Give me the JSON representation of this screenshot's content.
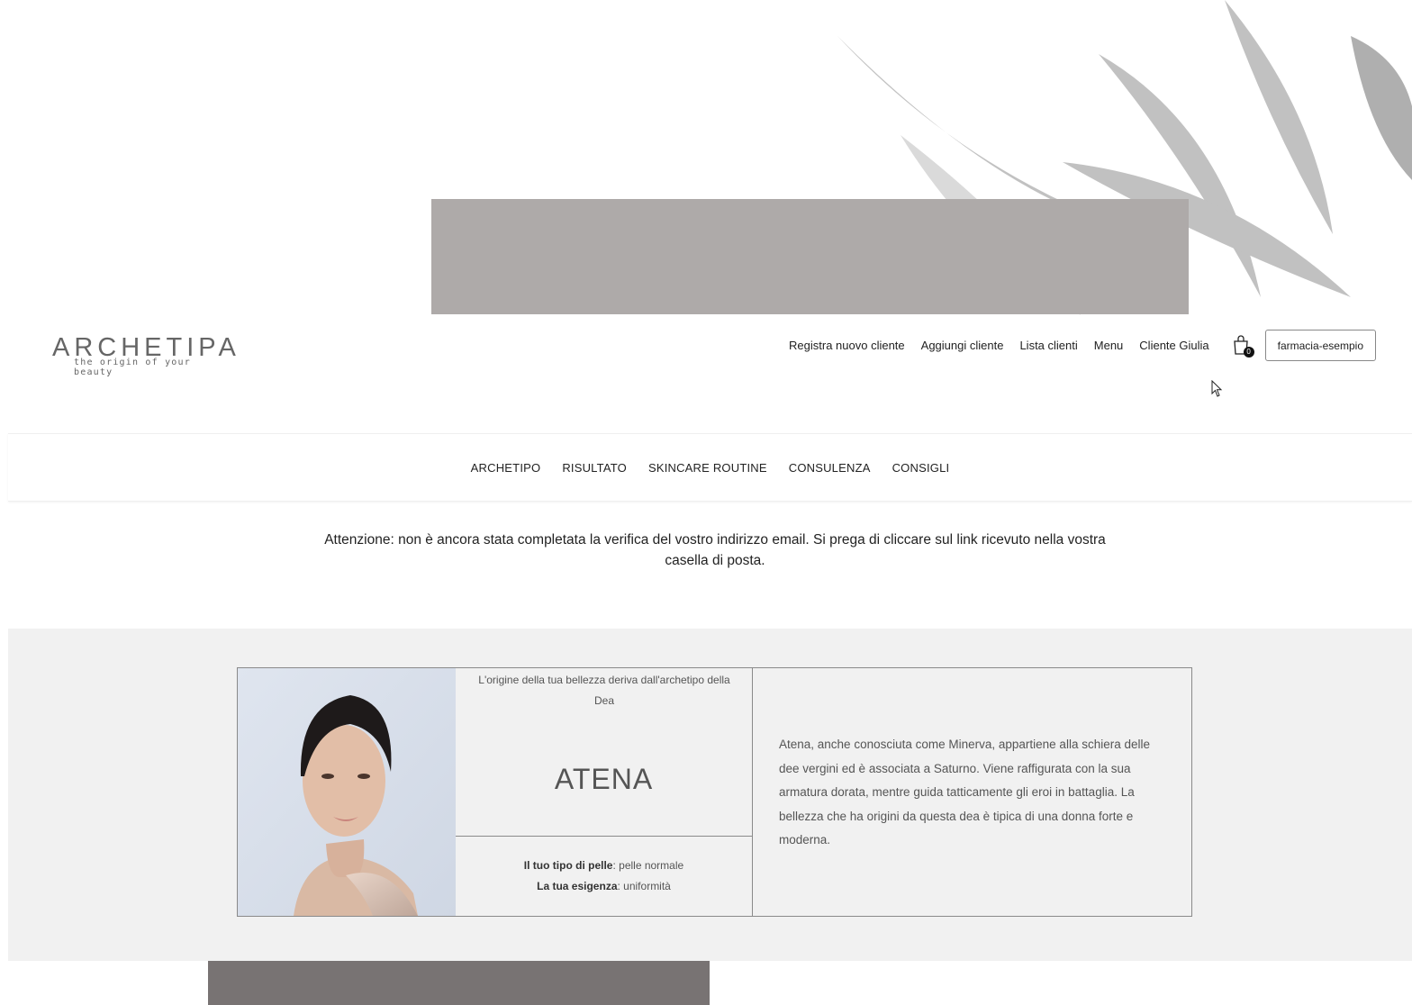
{
  "brand": {
    "name": "ARCHETIPA",
    "tagline": "the origin of your beauty"
  },
  "top_nav": {
    "links": [
      "Registra nuovo cliente",
      "Aggiungi cliente",
      "Lista clienti",
      "Menu",
      "Cliente Giulia"
    ],
    "cart_count": "0",
    "account": "farmacia-esempio"
  },
  "main_nav": {
    "items": [
      "ARCHETIPO",
      "RISULTATO",
      "SKINCARE ROUTINE",
      "CONSULENZA",
      "CONSIGLI"
    ]
  },
  "alert": {
    "text": "Attenzione: non è ancora stata completata la verifica del vostro indirizzo email. Si prega di cliccare sul link ricevuto nella vostra casella di posta."
  },
  "result_card": {
    "origin_text": "L'origine della tua bellezza deriva dall'archetipo della Dea",
    "goddess": "ATENA",
    "skin_type_label": "Il tuo tipo di pelle",
    "skin_type_value": "pelle normale",
    "need_label": "La tua esigenza",
    "need_value": "uniformità",
    "description": "Atena, anche conosciuta come Minerva, appartiene alla schiera delle dee vergini ed è associata a Saturno. Viene raffigurata con la sua armatura dorata, mentre guida tatticamente gli eroi in battaglia. La bellezza che ha origini da questa dea è tipica di una donna forte e moderna."
  },
  "colors": {
    "hero_box": "#aeaaa9",
    "section_bg": "#f1f1f1",
    "bottom_box": "#787373",
    "text": "#222222"
  }
}
